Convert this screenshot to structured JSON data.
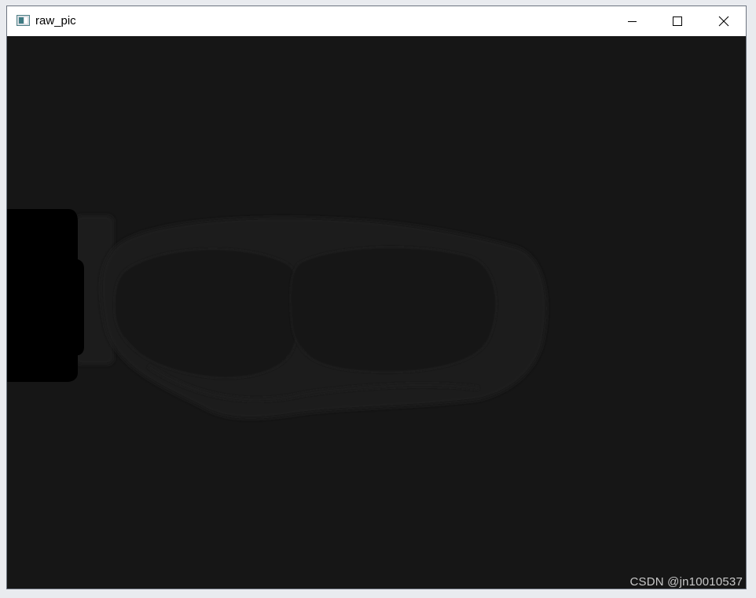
{
  "window": {
    "title": "raw_pic",
    "icon": "opencv-window-icon",
    "controls": {
      "minimize_icon": "minimize-icon",
      "maximize_icon": "maximize-icon",
      "close_icon": "close-icon"
    }
  },
  "image": {
    "description_icon": "goggles-image",
    "background_color": "#161616"
  },
  "watermark": {
    "text": "CSDN @jn10010537"
  }
}
